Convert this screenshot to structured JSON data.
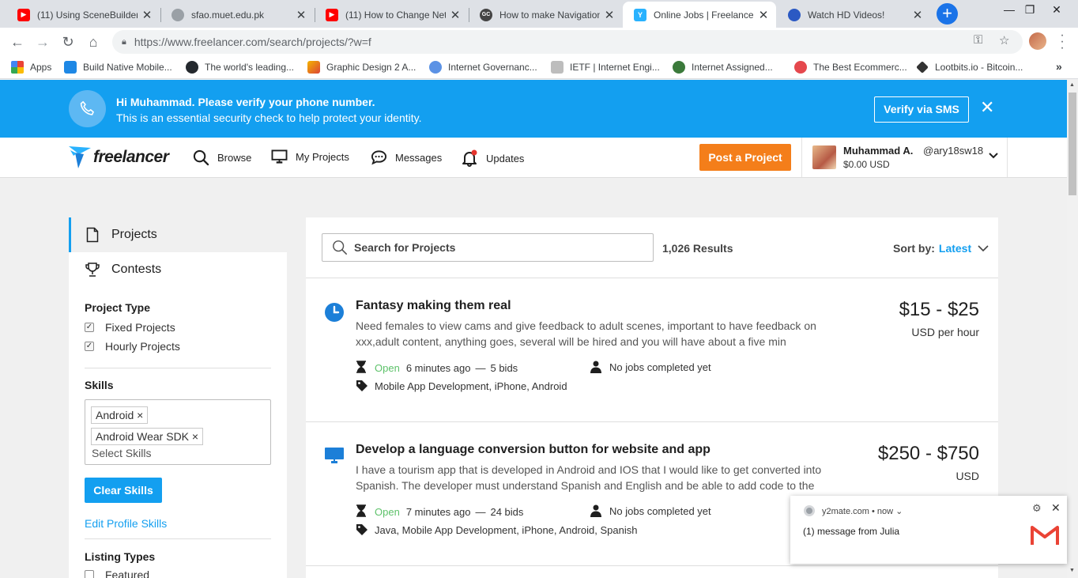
{
  "browser": {
    "tabs": [
      {
        "title": "(11) Using SceneBuilder",
        "favicon_color": "#ff0000",
        "active": false
      },
      {
        "title": "sfao.muet.edu.pk",
        "favicon_color": "#9aa0a6",
        "active": false
      },
      {
        "title": "(11) How to Change Net",
        "favicon_color": "#ff0000",
        "active": false
      },
      {
        "title": "How to make Navigation",
        "favicon_color": "#444444",
        "active": false
      },
      {
        "title": "Online Jobs | Freelance",
        "favicon_color": "#29b2fe",
        "active": true
      },
      {
        "title": "Watch HD Videos!",
        "favicon_color": "#2b59c3",
        "active": false
      }
    ],
    "url": "https://www.freelancer.com/search/projects/?w=f",
    "bookmarks": [
      {
        "label": "Apps",
        "color": "#ea4335"
      },
      {
        "label": "Build Native Mobile...",
        "color": "#1e88e5"
      },
      {
        "label": "The world's leading...",
        "color": "#24292e"
      },
      {
        "label": "Graphic Design 2 A...",
        "color": "#f4b400"
      },
      {
        "label": "Internet Governanc...",
        "color": "#5b92e5"
      },
      {
        "label": "IETF | Internet Engi...",
        "color": "#888888"
      },
      {
        "label": "Internet Assigned...",
        "color": "#3b7a3b"
      },
      {
        "label": "The Best Ecommerc...",
        "color": "#e5484d"
      },
      {
        "label": "Lootbits.io - Bitcoin...",
        "color": "#333333"
      }
    ]
  },
  "banner": {
    "line1": "Hi Muhammad. Please verify your phone number.",
    "line2": "This is an essential security check to help protect your identity.",
    "verify_label": "Verify via SMS"
  },
  "nav": {
    "logo": "freelancer",
    "items": [
      "Browse",
      "My Projects",
      "Messages",
      "Updates"
    ],
    "post_label": "Post a Project",
    "user_name": "Muhammad A.",
    "user_handle": "@ary18sw18",
    "balance": "$0.00 USD"
  },
  "sidebar": {
    "tabs": [
      "Projects",
      "Contests"
    ],
    "project_type_title": "Project Type",
    "project_types": [
      {
        "label": "Fixed Projects",
        "checked": true
      },
      {
        "label": "Hourly Projects",
        "checked": true
      }
    ],
    "skills_title": "Skills",
    "skills": [
      "Android",
      "Android Wear SDK"
    ],
    "skills_placeholder": "Select Skills",
    "clear_label": "Clear Skills",
    "edit_link": "Edit Profile Skills",
    "listing_title": "Listing Types",
    "listing_first": "Featured"
  },
  "main": {
    "search_placeholder": "Search for Projects",
    "results": "1,026 Results",
    "sort_label": "Sort by:",
    "sort_value": "Latest",
    "projects": [
      {
        "title": "Fantasy making them real",
        "description": "Need females to view cams and give feedback to adult scenes, important to have feedback on xxx,adult content, anything goes, several will be hired and you will have about a five min",
        "status": "Open",
        "time": "6 minutes ago",
        "bids": "5 bids",
        "client": "No jobs completed yet",
        "tags": "Mobile App Development, iPhone, Android",
        "price": "$15 - $25",
        "unit": "USD per hour",
        "icon": "clock-icon"
      },
      {
        "title": "Develop a language conversion button for website and app",
        "description": "I have a tourism app that is developed in Android and IOS that I would like to get converted into Spanish. The developer must understand Spanish and English and be able to add code to the",
        "status": "Open",
        "time": "7 minutes ago",
        "bids": "24 bids",
        "client": "No jobs completed yet",
        "tags": "Java, Mobile App Development, iPhone, Android, Spanish",
        "price": "$250 - $750",
        "unit": "USD",
        "icon": "monitor-icon"
      }
    ]
  },
  "notification": {
    "source": "y2mate.com",
    "when": "now",
    "message": "(1) message from Julia"
  },
  "colors": {
    "brand_blue": "#139ff0",
    "post_orange": "#f47e1a",
    "open_green": "#5dc26a"
  }
}
